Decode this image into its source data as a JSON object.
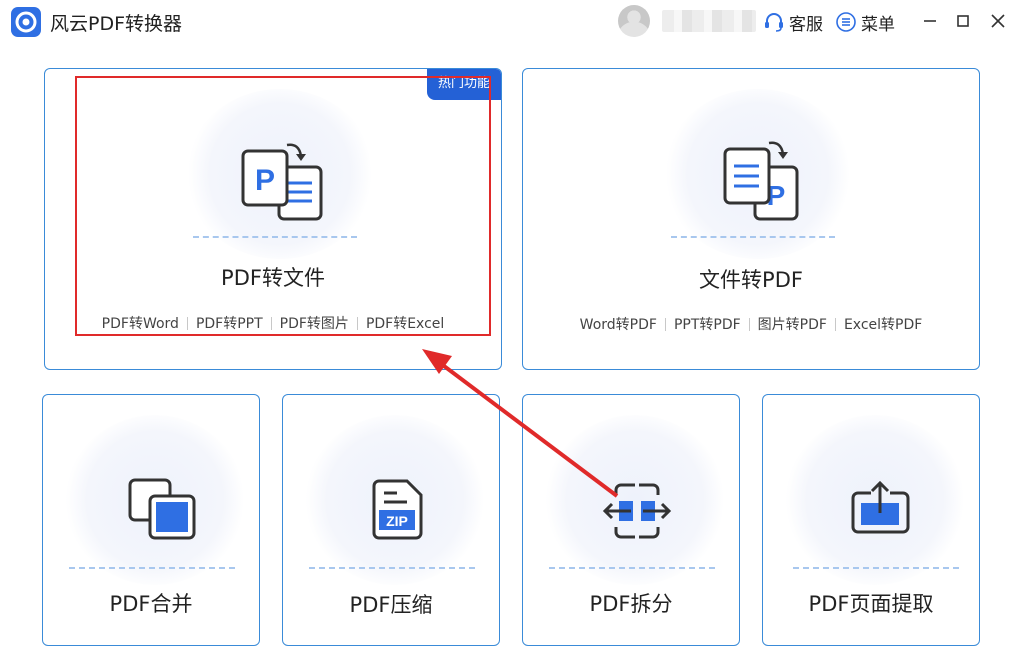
{
  "window": {
    "title": "风云PDF转换器",
    "service_label": "客服",
    "menu_label": "菜单"
  },
  "colors": {
    "accent": "#2f6fe3",
    "card_border": "#3a8bd8",
    "badge": "#2461d6",
    "annotation": "#e02a2a"
  },
  "cards": {
    "pdf_to_file": {
      "badge": "热门功能",
      "title": "PDF转文件",
      "links": [
        "PDF转Word",
        "PDF转PPT",
        "PDF转图片",
        "PDF转Excel"
      ]
    },
    "file_to_pdf": {
      "title": "文件转PDF",
      "links": [
        "Word转PDF",
        "PPT转PDF",
        "图片转PDF",
        "Excel转PDF"
      ]
    },
    "merge": {
      "title": "PDF合并"
    },
    "compress": {
      "title": "PDF压缩",
      "zip_label": "ZIP"
    },
    "split": {
      "title": "PDF拆分"
    },
    "extract": {
      "title": "PDF页面提取"
    }
  },
  "icons": {
    "app_logo": "app-logo-icon",
    "headset": "headset-icon",
    "menu": "menu-icon",
    "minimize": "minimize-icon",
    "maximize": "maximize-icon",
    "close": "close-icon",
    "pdf_to_doc": "pdf-to-document-icon",
    "doc_to_pdf": "document-to-pdf-icon",
    "merge": "merge-pages-icon",
    "zip": "zip-file-icon",
    "split": "split-arrows-icon",
    "extract": "page-extract-icon"
  }
}
